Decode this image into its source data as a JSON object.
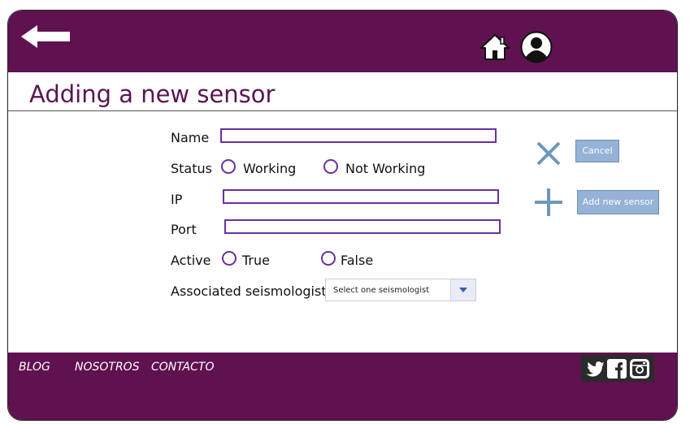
{
  "page": {
    "title": "Adding a new sensor"
  },
  "header": {
    "back_icon": "arrow-left-icon",
    "home_icon": "home-icon",
    "user_icon": "user-icon"
  },
  "form": {
    "name_label": "Name",
    "name_value": "",
    "status_label": "Status",
    "status_options": [
      "Working",
      "Not Working"
    ],
    "ip_label": "IP",
    "ip_value": "",
    "port_label": "Port",
    "port_value": "",
    "active_label": "Active",
    "active_options": [
      "True",
      "False"
    ],
    "seismologist_label": "Associated seismologist",
    "seismologist_selected": "Select one seismologist"
  },
  "actions": {
    "cancel_label": "Cancel",
    "cancel_icon": "close-icon",
    "add_label": "Add new sensor",
    "add_icon": "plus-icon"
  },
  "footer": {
    "links": [
      "BLOG",
      "NOSOTROS",
      "CONTACTO"
    ],
    "social_icons": [
      "twitter-icon",
      "facebook-icon",
      "instagram-icon"
    ]
  },
  "colors": {
    "brand": "#601150",
    "title_text": "#5b1452",
    "input_border": "#6b2fa0",
    "button_bg": "#94b3d6",
    "icon_blue": "#6d97be"
  }
}
